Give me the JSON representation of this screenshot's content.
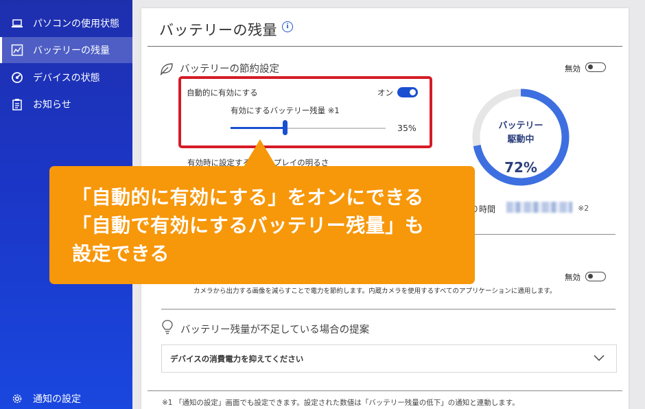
{
  "sidebar": {
    "items": [
      {
        "label": "パソコンの使用状態",
        "icon": "laptop-icon",
        "active": false
      },
      {
        "label": "バッテリーの残量",
        "icon": "chart-icon",
        "active": true
      },
      {
        "label": "デバイスの状態",
        "icon": "gauge-icon",
        "active": false
      },
      {
        "label": "お知らせ",
        "icon": "clipboard-icon",
        "active": false
      }
    ],
    "settings_label": "通知の設定"
  },
  "header": {
    "title": "バッテリーの残量",
    "info_glyph": "i"
  },
  "saver": {
    "title": "バッテリーの節約設定",
    "toggle_label": "無効",
    "auto_label": "自動的に有効にする",
    "auto_state": "オン",
    "threshold_label": "有効にするバッテリー残量 ※1",
    "threshold_value": "35%",
    "threshold_fraction": 0.35,
    "brightness_label": "有効時に設定するディスプレイの明るさ"
  },
  "battery": {
    "status_line1": "バッテリー",
    "status_line2": "駆動中",
    "percent_text": "72%",
    "percent_value": 72,
    "remaining_label": "り時間",
    "remaining_note": "※2"
  },
  "camera": {
    "toggle_label": "無効",
    "description": "カメラから出力する画像を減らすことで電力を節約します。内蔵カメラを使用するすべてのアプリケーションに適用します。"
  },
  "proposal": {
    "title": "バッテリー残量が不足している場合の提案",
    "item_label": "デバイスの消費電力を抑えてください"
  },
  "footnote": "※1 「通知の設定」画面でも設定できます。設定された数値は「バッテリー残量の低下」の通知と連動します。",
  "callout": {
    "lines": [
      "「自動的に有効にする」をオンにできる",
      "「自動で有効にするバッテリー残量」も",
      "設定できる"
    ]
  },
  "colors": {
    "accent": "#1a4fd0",
    "highlight": "#d61b26",
    "callout": "#f7970a",
    "donut_ring": "#3d6fe0",
    "donut_track": "#e6e6e6"
  }
}
